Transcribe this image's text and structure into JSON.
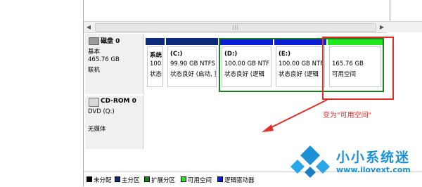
{
  "scrollbar": {
    "left_arrow": "◀",
    "thumb_grip": "|||",
    "right_arrow": "▶"
  },
  "disk0": {
    "title": "磁盘 0",
    "type": "基本",
    "size": "465.76 GB",
    "status": "联机",
    "partitions": [
      {
        "bar_color": "#0b2a7a",
        "name": "系统",
        "size": "100",
        "status": "状态良"
      },
      {
        "bar_color": "#0b2a7a",
        "name": "(C:)",
        "size": "99.90 GB NTFS",
        "status": "状态良好 (启动, 页"
      },
      {
        "bar_color": "#0a1fd6",
        "name": "(D:)",
        "size": "100.00 GB NTF",
        "status": "状态良好 (逻辑"
      },
      {
        "bar_color": "#0a1fd6",
        "name": "(E:)",
        "size": "100.00 GB NTF",
        "status": "状态良好 (逻辑"
      },
      {
        "bar_color": "#22e61e",
        "name": "",
        "size": "165.76 GB",
        "status": "可用空间"
      }
    ]
  },
  "cdrom0": {
    "title": "CD-ROM 0",
    "drive": "DVD (Q:)",
    "media": "无媒体"
  },
  "annotation": "变为\"可用空间\"",
  "legend": [
    {
      "color": "#000000",
      "label": "未分配"
    },
    {
      "color": "#0b2a7a",
      "label": "主分区"
    },
    {
      "color": "#1a7f1a",
      "label": "扩展分区"
    },
    {
      "color": "#22e61e",
      "label": "可用空间"
    },
    {
      "color": "#0a1fd6",
      "label": "逻辑驱动器"
    }
  ],
  "brand": {
    "name": "小小系统迷",
    "url": "www.ilovext.com"
  },
  "colors": {
    "annotation_red": "#e0302c",
    "brand_blue": "#1e90d6"
  }
}
